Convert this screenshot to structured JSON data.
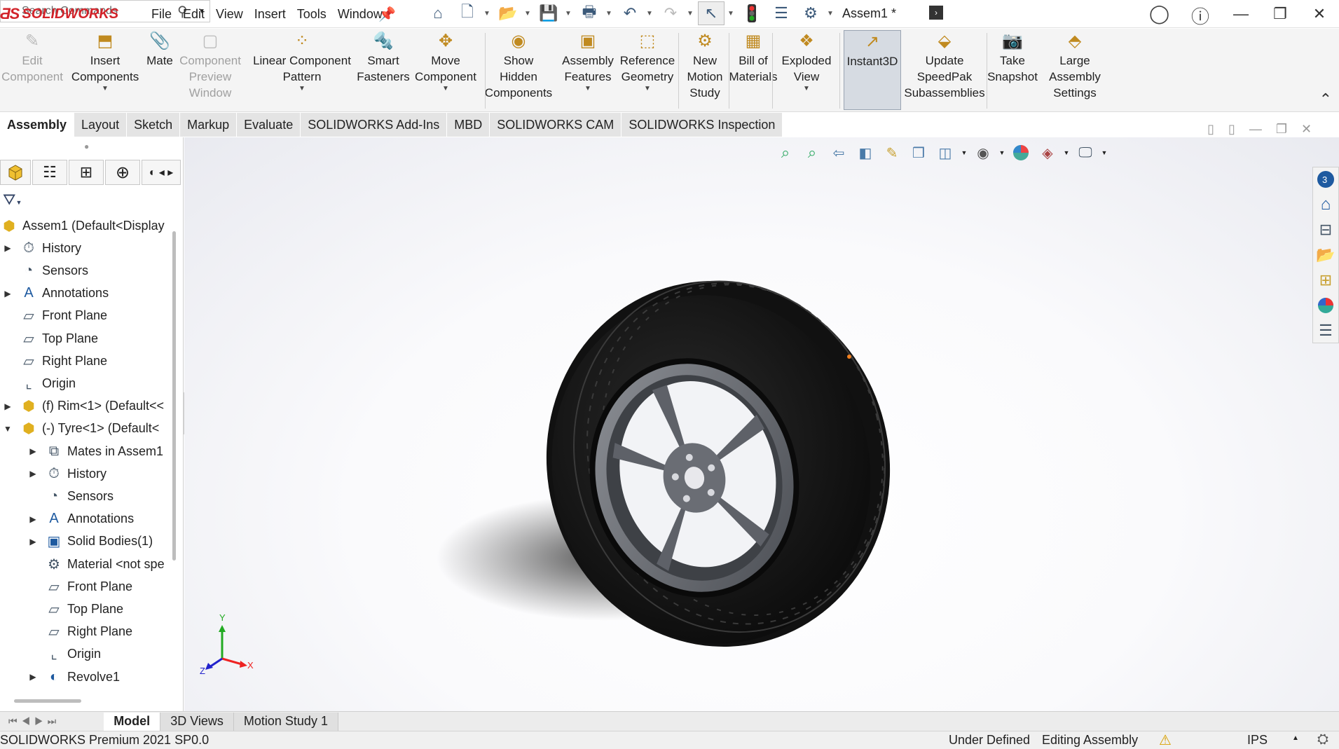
{
  "app": {
    "brand": "SOLIDWORKS",
    "doc_title": "Assem1 *"
  },
  "menu": [
    "File",
    "Edit",
    "View",
    "Insert",
    "Tools",
    "Window"
  ],
  "search": {
    "placeholder": "Search Commands"
  },
  "command_manager": [
    {
      "id": "edit-component",
      "lines": [
        "Edit",
        "Component"
      ],
      "disabled": true,
      "caret": false
    },
    {
      "id": "insert-components",
      "lines": [
        "Insert",
        "Components"
      ],
      "disabled": false,
      "caret": true
    },
    {
      "id": "mate",
      "lines": [
        "Mate"
      ],
      "disabled": false,
      "caret": false
    },
    {
      "id": "component-preview-window",
      "lines": [
        "Component",
        "Preview",
        "Window"
      ],
      "disabled": true,
      "caret": false
    },
    {
      "id": "linear-component-pattern",
      "lines": [
        "Linear Component",
        "Pattern"
      ],
      "disabled": false,
      "caret": true
    },
    {
      "id": "smart-fasteners",
      "lines": [
        "Smart",
        "Fasteners"
      ],
      "disabled": false,
      "caret": false
    },
    {
      "id": "move-component",
      "lines": [
        "Move",
        "Component"
      ],
      "disabled": false,
      "caret": true
    },
    {
      "id": "show-hidden-components",
      "lines": [
        "Show",
        "Hidden",
        "Components"
      ],
      "disabled": false,
      "caret": false
    },
    {
      "id": "assembly-features",
      "lines": [
        "Assembly",
        "Features"
      ],
      "disabled": false,
      "caret": true
    },
    {
      "id": "reference-geometry",
      "lines": [
        "Reference",
        "Geometry"
      ],
      "disabled": false,
      "caret": true
    },
    {
      "id": "new-motion-study",
      "lines": [
        "New",
        "Motion",
        "Study"
      ],
      "disabled": false,
      "caret": false
    },
    {
      "id": "bill-of-materials",
      "lines": [
        "Bill of",
        "Materials"
      ],
      "disabled": false,
      "caret": false
    },
    {
      "id": "exploded-view",
      "lines": [
        "Exploded",
        "View"
      ],
      "disabled": false,
      "caret": true
    },
    {
      "id": "instant3d",
      "lines": [
        "Instant3D"
      ],
      "disabled": false,
      "caret": false,
      "active": true
    },
    {
      "id": "update-speedpak",
      "lines": [
        "Update",
        "SpeedPak",
        "Subassemblies"
      ],
      "disabled": false,
      "caret": false
    },
    {
      "id": "take-snapshot",
      "lines": [
        "Take",
        "Snapshot"
      ],
      "disabled": false,
      "caret": false
    },
    {
      "id": "large-assembly-settings",
      "lines": [
        "Large",
        "Assembly",
        "Settings"
      ],
      "disabled": false,
      "caret": false
    }
  ],
  "tabs": [
    "Assembly",
    "Layout",
    "Sketch",
    "Markup",
    "Evaluate",
    "SOLIDWORKS Add-Ins",
    "MBD",
    "SOLIDWORKS CAM",
    "SOLIDWORKS Inspection"
  ],
  "tree": [
    {
      "label": "Assem1  (Default<Display",
      "icon": "assembly-icon",
      "level": 0,
      "exp": ""
    },
    {
      "label": "History",
      "icon": "history-icon",
      "level": 1,
      "exp": "▶"
    },
    {
      "label": "Sensors",
      "icon": "sensor-icon",
      "level": 1,
      "exp": ""
    },
    {
      "label": "Annotations",
      "icon": "annotation-icon",
      "level": 1,
      "exp": "▶"
    },
    {
      "label": "Front Plane",
      "icon": "plane-icon",
      "level": 1,
      "exp": ""
    },
    {
      "label": "Top Plane",
      "icon": "plane-icon",
      "level": 1,
      "exp": ""
    },
    {
      "label": "Right Plane",
      "icon": "plane-icon",
      "level": 1,
      "exp": ""
    },
    {
      "label": "Origin",
      "icon": "origin-icon",
      "level": 1,
      "exp": ""
    },
    {
      "label": "(f) Rim<1> (Default<<",
      "icon": "part-icon",
      "level": 1,
      "exp": "▶"
    },
    {
      "label": "(-) Tyre<1> (Default<",
      "icon": "part-icon",
      "level": 1,
      "exp": "▼"
    },
    {
      "label": "Mates in Assem1",
      "icon": "mates-icon",
      "level": 2,
      "exp": "▶"
    },
    {
      "label": "History",
      "icon": "history-icon",
      "level": 2,
      "exp": "▶"
    },
    {
      "label": "Sensors",
      "icon": "sensor-icon",
      "level": 2,
      "exp": ""
    },
    {
      "label": "Annotations",
      "icon": "annotation-icon",
      "level": 2,
      "exp": "▶"
    },
    {
      "label": "Solid Bodies(1)",
      "icon": "solid-bodies-icon",
      "level": 2,
      "exp": "▶"
    },
    {
      "label": "Material <not spe",
      "icon": "material-icon",
      "level": 2,
      "exp": ""
    },
    {
      "label": "Front Plane",
      "icon": "plane-icon",
      "level": 2,
      "exp": ""
    },
    {
      "label": "Top Plane",
      "icon": "plane-icon",
      "level": 2,
      "exp": ""
    },
    {
      "label": "Right Plane",
      "icon": "plane-icon",
      "level": 2,
      "exp": ""
    },
    {
      "label": "Origin",
      "icon": "origin-icon",
      "level": 2,
      "exp": ""
    },
    {
      "label": "Revolve1",
      "icon": "revolve-icon",
      "level": 2,
      "exp": "▶"
    }
  ],
  "bottom_tabs": [
    "Model",
    "3D Views",
    "Motion Study 1"
  ],
  "status": {
    "product": "SOLIDWORKS Premium 2021 SP0.0",
    "state": "Under Defined",
    "mode": "Editing Assembly",
    "units": "IPS"
  },
  "triad": {
    "x": "X",
    "y": "Y",
    "z": "Z"
  },
  "colors": {
    "brand": "#d2232a",
    "tyre": "#1a1a1a",
    "rim": "#5c5f66",
    "accent": "#3c6fb0"
  }
}
